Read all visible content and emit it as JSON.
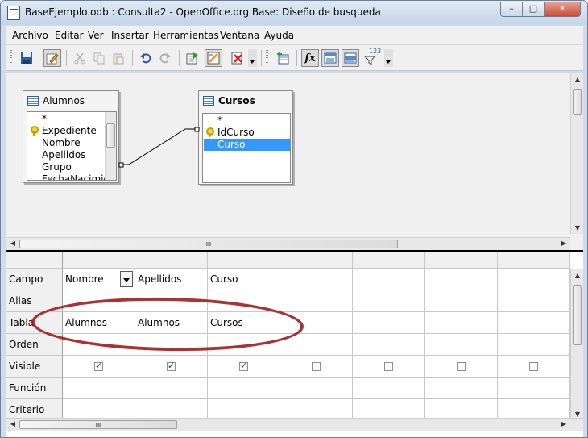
{
  "window": {
    "title": "BaseEjemplo.odb : Consulta2 - OpenOffice.org Base: Diseño de busqueda",
    "minimize": "–",
    "maximize": "□",
    "close": "✕"
  },
  "menu": [
    {
      "label": "Archivo"
    },
    {
      "label": "Editar"
    },
    {
      "label": "Ver"
    },
    {
      "label": "Insertar"
    },
    {
      "label": "Herramientas"
    },
    {
      "label": "Ventana"
    },
    {
      "label": "Ayuda"
    }
  ],
  "toolbar": {
    "buttons": [
      {
        "name": "save-icon"
      },
      {
        "name": "edit-mode-icon",
        "pressed": true
      },
      {
        "name": "cut-icon"
      },
      {
        "name": "copy-icon"
      },
      {
        "name": "paste-icon"
      },
      {
        "name": "undo-icon"
      },
      {
        "name": "redo-icon"
      },
      {
        "name": "run-query-icon"
      },
      {
        "name": "design-view-icon",
        "pressed": true
      },
      {
        "name": "clear-query-icon"
      },
      {
        "name": "add-table-icon"
      },
      {
        "name": "function-icon",
        "label": "fx",
        "pressed": true
      },
      {
        "name": "table-name-icon",
        "pressed": true
      },
      {
        "name": "alias-icon",
        "pressed": true
      },
      {
        "name": "distinct-filter-icon",
        "label": "123"
      }
    ]
  },
  "tables": [
    {
      "name": "Alumnos",
      "fields": [
        "*",
        "Expediente",
        "Nombre",
        "Apellidos",
        "Grupo",
        "FechaNacimie"
      ],
      "key_field": "Expediente"
    },
    {
      "name": "Cursos",
      "fields": [
        "*",
        "IdCurso",
        "Curso"
      ],
      "key_field": "IdCurso",
      "selected_field": "Curso"
    }
  ],
  "grid": {
    "row_labels": [
      "Campo",
      "Alias",
      "Tabla",
      "Orden",
      "Visible",
      "Función",
      "Criterio"
    ],
    "columns": [
      {
        "campo": "Nombre",
        "alias": "",
        "tabla": "Alumnos",
        "orden": "",
        "visible": true
      },
      {
        "campo": "Apellidos",
        "alias": "",
        "tabla": "Alumnos",
        "orden": "",
        "visible": true
      },
      {
        "campo": "Curso",
        "alias": "",
        "tabla": "Cursos",
        "orden": "",
        "visible": true
      },
      {
        "campo": "",
        "alias": "",
        "tabla": "",
        "orden": "",
        "visible": false
      },
      {
        "campo": "",
        "alias": "",
        "tabla": "",
        "orden": "",
        "visible": false
      },
      {
        "campo": "",
        "alias": "",
        "tabla": "",
        "orden": "",
        "visible": false
      },
      {
        "campo": "",
        "alias": "",
        "tabla": "",
        "orden": "",
        "visible": false
      }
    ],
    "scroll_grip": "III"
  },
  "colors": {
    "highlight": "#3399ff",
    "annotation": "#a11c1c"
  }
}
